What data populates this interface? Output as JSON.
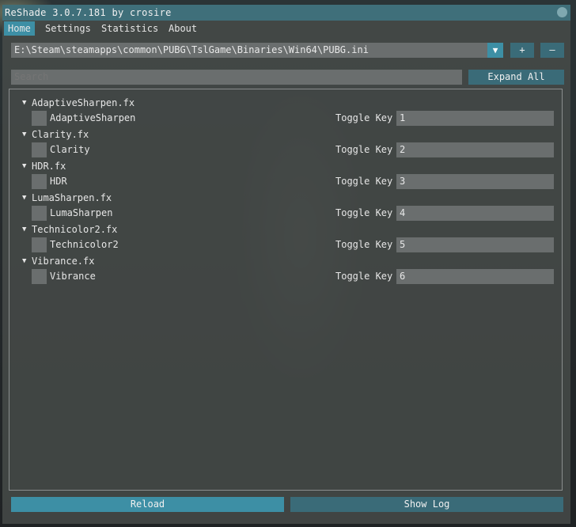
{
  "window": {
    "title": "ReShade 3.0.7.181 by crosire"
  },
  "menu": [
    "Home",
    "Settings",
    "Statistics",
    "About"
  ],
  "preset": {
    "path": "E:\\Steam\\steamapps\\common\\PUBG\\TslGame\\Binaries\\Win64\\PUBG.ini",
    "add_label": "+",
    "remove_label": "–"
  },
  "search": {
    "placeholder": "Search",
    "value": ""
  },
  "expand_all_label": "Expand All",
  "groups": [
    {
      "file": "AdaptiveSharpen.fx",
      "technique": "AdaptiveSharpen",
      "toggle_label": "Toggle Key",
      "key": "1"
    },
    {
      "file": "Clarity.fx",
      "technique": "Clarity",
      "toggle_label": "Toggle Key",
      "key": "2"
    },
    {
      "file": "HDR.fx",
      "technique": "HDR",
      "toggle_label": "Toggle Key",
      "key": "3"
    },
    {
      "file": "LumaSharpen.fx",
      "technique": "LumaSharpen",
      "toggle_label": "Toggle Key",
      "key": "4"
    },
    {
      "file": "Technicolor2.fx",
      "technique": "Technicolor2",
      "toggle_label": "Toggle Key",
      "key": "5"
    },
    {
      "file": "Vibrance.fx",
      "technique": "Vibrance",
      "toggle_label": "Toggle Key",
      "key": "6"
    }
  ],
  "footer": {
    "reload_label": "Reload",
    "show_log_label": "Show Log"
  },
  "icons": {
    "expanded": "triangle-down-icon",
    "dropdown": "triangle-down-icon"
  },
  "colors": {
    "title_bar": "#3f6f7a",
    "accent": "#3d8fa5",
    "button": "#3a6b78",
    "field": "#6a6e6e"
  }
}
